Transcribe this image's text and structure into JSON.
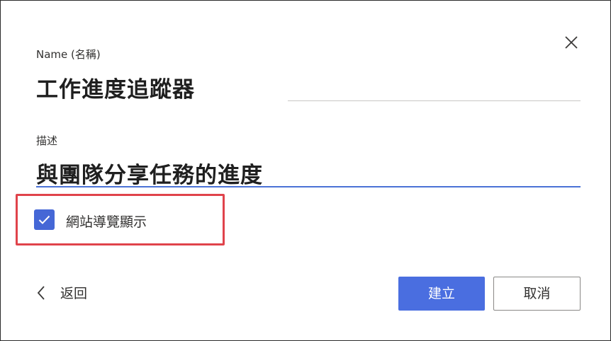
{
  "form": {
    "name_label": "Name (名稱)",
    "name_value": "工作進度追蹤器",
    "description_label": "描述",
    "description_value": "與團隊分享任務的進度",
    "checkbox_label": "網站導覽顯示",
    "checkbox_checked": true
  },
  "actions": {
    "back_label": "返回",
    "create_label": "建立",
    "cancel_label": "取消"
  },
  "icons": {
    "close": "close-icon",
    "back": "chevron-left-icon",
    "check": "checkmark-icon"
  },
  "colors": {
    "accent": "#4a6ee0",
    "checkbox": "#4567d6",
    "focus_underline": "#4a72d6",
    "highlight": "#e0434b"
  }
}
